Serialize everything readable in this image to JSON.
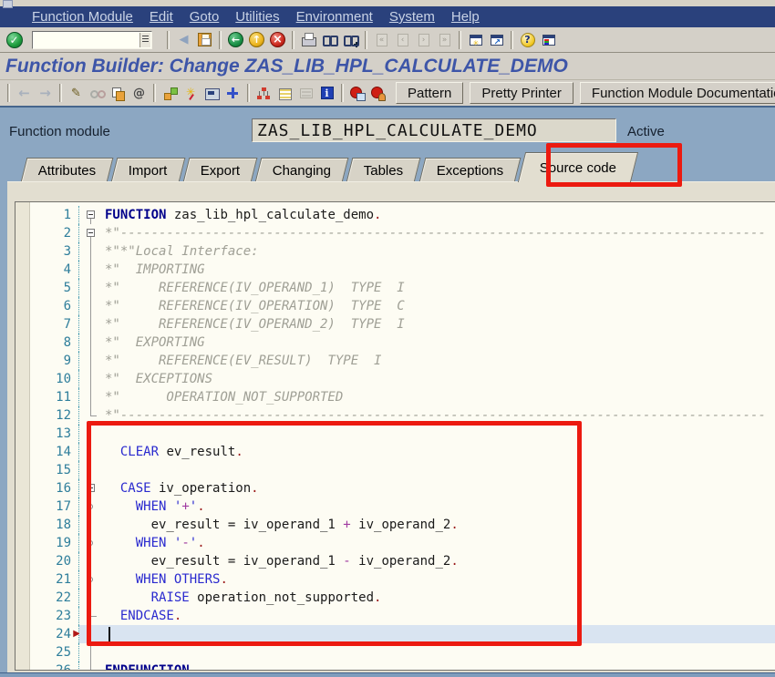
{
  "title": "Function Builder: Change ZAS_LIB_HPL_CALCULATE_DEMO",
  "menubar": {
    "items": [
      "Function Module",
      "Edit",
      "Goto",
      "Utilities",
      "Environment",
      "System",
      "Help"
    ]
  },
  "standard_toolbar": {
    "enter_icon": "enter-check",
    "command_field": {
      "value": ""
    },
    "groups": [
      [
        {
          "name": "back-triangle"
        },
        {
          "name": "save"
        }
      ],
      [
        {
          "name": "nav-back"
        },
        {
          "name": "nav-exit"
        },
        {
          "name": "nav-cancel"
        }
      ],
      [
        {
          "name": "print"
        },
        {
          "name": "find"
        },
        {
          "name": "find-next"
        }
      ],
      [
        {
          "name": "first-page",
          "disabled": true
        },
        {
          "name": "previous-page",
          "disabled": true
        },
        {
          "name": "next-page",
          "disabled": true
        },
        {
          "name": "last-page",
          "disabled": true
        }
      ],
      [
        {
          "name": "new-session"
        },
        {
          "name": "create-shortcut"
        }
      ],
      [
        {
          "name": "help"
        },
        {
          "name": "customize-layout"
        }
      ]
    ]
  },
  "app_toolbar": {
    "groups": [
      [
        {
          "name": "nav-left",
          "disabled": true
        },
        {
          "name": "nav-right",
          "disabled": true
        }
      ],
      [
        {
          "name": "display-change"
        },
        {
          "name": "refresh",
          "disabled": true
        },
        {
          "name": "copy"
        },
        {
          "name": "activate"
        }
      ],
      [
        {
          "name": "jump"
        },
        {
          "name": "activate-wand"
        },
        {
          "name": "test"
        },
        {
          "name": "where-used"
        }
      ],
      [
        {
          "name": "hierarchy"
        },
        {
          "name": "sort"
        },
        {
          "name": "detail",
          "disabled": true
        },
        {
          "name": "info"
        }
      ],
      [
        {
          "name": "breakpoint-screen"
        },
        {
          "name": "breakpoint-user"
        }
      ]
    ],
    "buttons": [
      "Pattern",
      "Pretty Printer",
      "Function Module Documentation"
    ]
  },
  "function_module": {
    "label": "Function module",
    "value": "ZAS_LIB_HPL_CALCULATE_DEMO",
    "status": "Active"
  },
  "tabs": {
    "items": [
      "Attributes",
      "Import",
      "Export",
      "Changing",
      "Tables",
      "Exceptions",
      "Source code"
    ],
    "active": "Source code"
  },
  "editor": {
    "lines": [
      {
        "n": 1,
        "fold": "box",
        "parts": [
          [
            "kwb",
            "FUNCTION"
          ],
          [
            "id",
            " zas_lib_hpl_calculate_demo"
          ],
          [
            "dot",
            "."
          ]
        ]
      },
      {
        "n": 2,
        "fold": "box",
        "parts": [
          [
            "cm",
            "*\"------------------------------------------------------------------------------------"
          ]
        ]
      },
      {
        "n": 3,
        "fold": "vline",
        "parts": [
          [
            "cm",
            "*\"*\"Local Interface:"
          ]
        ]
      },
      {
        "n": 4,
        "fold": "vline",
        "parts": [
          [
            "cm",
            "*\"  IMPORTING"
          ]
        ]
      },
      {
        "n": 5,
        "fold": "vline",
        "parts": [
          [
            "cm",
            "*\"     REFERENCE(IV_OPERAND_1)  TYPE  I"
          ]
        ]
      },
      {
        "n": 6,
        "fold": "vline",
        "parts": [
          [
            "cm",
            "*\"     REFERENCE(IV_OPERATION)  TYPE  C"
          ]
        ]
      },
      {
        "n": 7,
        "fold": "vline",
        "parts": [
          [
            "cm",
            "*\"     REFERENCE(IV_OPERAND_2)  TYPE  I"
          ]
        ]
      },
      {
        "n": 8,
        "fold": "vline",
        "parts": [
          [
            "cm",
            "*\"  EXPORTING"
          ]
        ]
      },
      {
        "n": 9,
        "fold": "vline",
        "parts": [
          [
            "cm",
            "*\"     REFERENCE(EV_RESULT)  TYPE  I"
          ]
        ]
      },
      {
        "n": 10,
        "fold": "vline",
        "parts": [
          [
            "cm",
            "*\"  EXCEPTIONS"
          ]
        ]
      },
      {
        "n": 11,
        "fold": "vline",
        "parts": [
          [
            "cm",
            "*\"      OPERATION_NOT_SUPPORTED"
          ]
        ]
      },
      {
        "n": 12,
        "fold": "end",
        "parts": [
          [
            "cm",
            "*\"------------------------------------------------------------------------------------"
          ]
        ]
      },
      {
        "n": 13,
        "fold": "vline",
        "parts": []
      },
      {
        "n": 14,
        "fold": "vline",
        "parts": [
          [
            "id",
            "  "
          ],
          [
            "kw",
            "CLEAR"
          ],
          [
            "id",
            " ev_result"
          ],
          [
            "dot",
            "."
          ]
        ]
      },
      {
        "n": 15,
        "fold": "vline",
        "parts": []
      },
      {
        "n": 16,
        "fold": "box",
        "parts": [
          [
            "id",
            "  "
          ],
          [
            "kw",
            "CASE"
          ],
          [
            "id",
            " iv_operation"
          ],
          [
            "dot",
            "."
          ]
        ]
      },
      {
        "n": 17,
        "fold": "circle",
        "parts": [
          [
            "id",
            "    "
          ],
          [
            "kw",
            "WHEN"
          ],
          [
            "id",
            " "
          ],
          [
            "str",
            "'"
          ],
          [
            "op",
            "+"
          ],
          [
            "str",
            "'"
          ],
          [
            "dot",
            "."
          ]
        ]
      },
      {
        "n": 18,
        "fold": "vline",
        "parts": [
          [
            "id",
            "      ev_result = iv_operand_1 "
          ],
          [
            "op",
            "+"
          ],
          [
            "id",
            " iv_operand_2"
          ],
          [
            "dot",
            "."
          ]
        ]
      },
      {
        "n": 19,
        "fold": "circle",
        "parts": [
          [
            "id",
            "    "
          ],
          [
            "kw",
            "WHEN"
          ],
          [
            "id",
            " "
          ],
          [
            "str",
            "'"
          ],
          [
            "op",
            "-"
          ],
          [
            "str",
            "'"
          ],
          [
            "dot",
            "."
          ]
        ]
      },
      {
        "n": 20,
        "fold": "vline",
        "parts": [
          [
            "id",
            "      ev_result = iv_operand_1 "
          ],
          [
            "op",
            "-"
          ],
          [
            "id",
            " iv_operand_2"
          ],
          [
            "dot",
            "."
          ]
        ]
      },
      {
        "n": 21,
        "fold": "circle",
        "parts": [
          [
            "id",
            "    "
          ],
          [
            "kw",
            "WHEN OTHERS"
          ],
          [
            "dot",
            "."
          ]
        ]
      },
      {
        "n": 22,
        "fold": "vline",
        "parts": [
          [
            "id",
            "      "
          ],
          [
            "kw",
            "RAISE"
          ],
          [
            "id",
            " operation_not_supported"
          ],
          [
            "dot",
            "."
          ]
        ]
      },
      {
        "n": 23,
        "fold": "end",
        "parts": [
          [
            "id",
            "  "
          ],
          [
            "kw",
            "ENDCASE"
          ],
          [
            "dot",
            "."
          ]
        ]
      },
      {
        "n": 24,
        "fold": "vline",
        "parts": [],
        "hl": true,
        "marker": true,
        "caret": true
      },
      {
        "n": 25,
        "fold": "vline",
        "parts": []
      },
      {
        "n": 26,
        "fold": "end",
        "parts": [
          [
            "kwb",
            "ENDFUNCTION"
          ],
          [
            "dot",
            "."
          ]
        ]
      }
    ]
  },
  "annotations": {
    "color": "#EC1A10",
    "targets": [
      "source-code-tab",
      "source-lines-13-24"
    ]
  },
  "colors": {
    "menu_bar": "#2A417C",
    "toolbar_face": "#D4D0C8",
    "screen_background": "#8CA7C2",
    "panel_background": "#E2DED0",
    "editor_background": "#FDFCF3",
    "line_highlight": "#D9E4F1",
    "line_numbers": "#2E7E9B",
    "keyword": "#2A2ACF",
    "keyword_bold": "#00008B",
    "comment": "#9F9F95",
    "title_text": "#3D55A8",
    "annotation_red": "#EC1A10"
  }
}
